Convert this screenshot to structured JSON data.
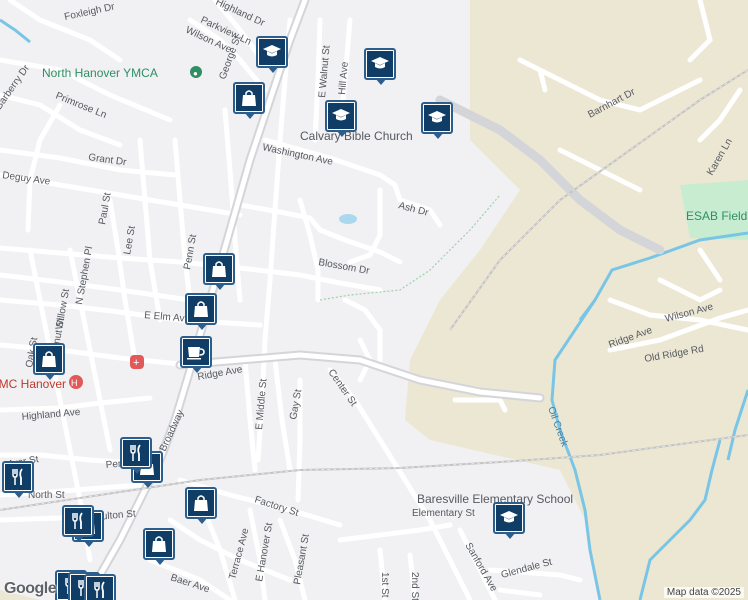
{
  "map": {
    "attribution": "Map data ©2025",
    "logo": "Google",
    "colors": {
      "land": "#f1f0f2",
      "rural": "#ece7d3",
      "park": "#c8ecd0",
      "water": "#79c5e6",
      "road": "#ffffff",
      "major_road": "#c9cbd0",
      "pin_border": "#2b5e8c",
      "pin_fill": "#0f3d66"
    },
    "streets": [
      "Foxleigh Dr",
      "Parkview Ln",
      "Wilson Ave",
      "Barberry Dr",
      "Primrose Ln",
      "George St",
      "E Walnut St",
      "Highland Dr",
      "Hill Ave",
      "Barnhart Dr",
      "Washington Ave",
      "Grant Dr",
      "Deguy Ave",
      "Ash Dr",
      "Karen Ln",
      "Paul St",
      "Lee St",
      "Penn St",
      "Blossom Dr",
      "N Stephen Pl",
      "Willow St",
      "E Elm Ave",
      "Wilson Ave",
      "Ridge Ave",
      "Old Ridge Rd",
      "Oak St",
      "Ridge Ave",
      "E Middle St",
      "Gay St",
      "Center St",
      "Highland Ave",
      "Oil Creek",
      "Factory St",
      "North St",
      "Fulton St",
      "Terrace Ave",
      "E Hanover St",
      "Pleasant St",
      "Baer Ave",
      "Sanford Ave",
      "Glendale St",
      "Broadway",
      "Elementary St",
      "Penn St",
      "Chestnut St",
      "Myer St",
      "1st St",
      "2nd St"
    ],
    "places": [
      {
        "name": "North Hanover YMCA",
        "icon": "gym-icon"
      },
      {
        "name": "Calvary Bible Church",
        "icon": "church-icon"
      },
      {
        "name": "ESAB Field",
        "icon": "park-icon"
      },
      {
        "name": "Baresville Elementary School",
        "icon": "school-icon"
      },
      {
        "name": "UPMC Hanover",
        "icon": "hospital-icon"
      }
    ],
    "markers": [
      {
        "type": "school",
        "icon": "graduation-cap-icon"
      },
      {
        "type": "school",
        "icon": "graduation-cap-icon"
      },
      {
        "type": "school",
        "icon": "graduation-cap-icon"
      },
      {
        "type": "school",
        "icon": "graduation-cap-icon"
      },
      {
        "type": "school",
        "icon": "graduation-cap-icon"
      },
      {
        "type": "shopping",
        "icon": "shopping-bag-icon"
      },
      {
        "type": "shopping",
        "icon": "shopping-bag-icon"
      },
      {
        "type": "shopping",
        "icon": "shopping-bag-icon"
      },
      {
        "type": "shopping",
        "icon": "shopping-bag-icon"
      },
      {
        "type": "shopping",
        "icon": "shopping-bag-icon"
      },
      {
        "type": "shopping",
        "icon": "shopping-bag-icon"
      },
      {
        "type": "shopping",
        "icon": "shopping-bag-icon"
      },
      {
        "type": "shopping",
        "icon": "shopping-bag-icon"
      },
      {
        "type": "cafe",
        "icon": "coffee-cup-icon"
      },
      {
        "type": "restaurant",
        "icon": "fork-knife-icon"
      },
      {
        "type": "restaurant",
        "icon": "fork-knife-icon"
      },
      {
        "type": "restaurant",
        "icon": "fork-knife-icon"
      },
      {
        "type": "restaurant",
        "icon": "fork-knife-icon"
      },
      {
        "type": "restaurant",
        "icon": "fork-knife-icon"
      },
      {
        "type": "restaurant",
        "icon": "fork-knife-icon"
      }
    ]
  }
}
